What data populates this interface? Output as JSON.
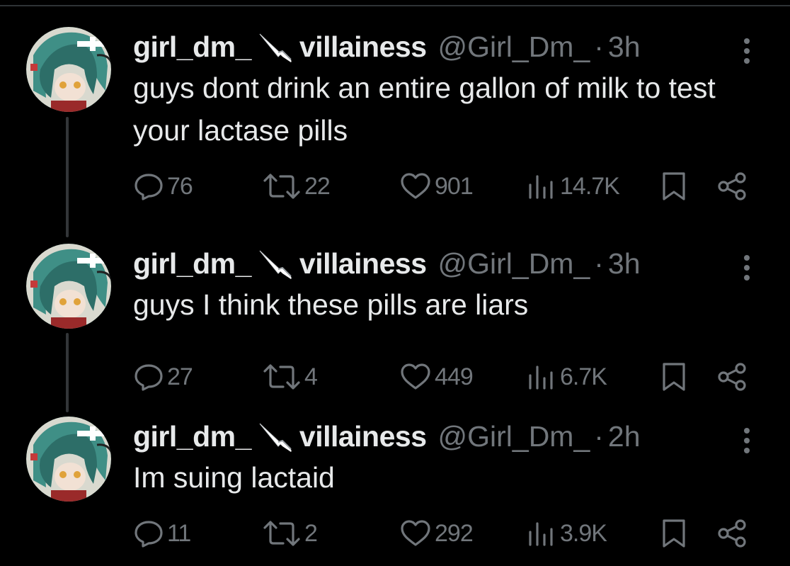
{
  "tweets": [
    {
      "display_name": "girl_dm_",
      "name_suffix": "villainess",
      "handle": "@Girl_Dm_",
      "separator": "·",
      "time": "3h",
      "text": "guys dont drink an entire gallon of milk to test your lactase pills",
      "replies": "76",
      "retweets": "22",
      "likes": "901",
      "views": "14.7K"
    },
    {
      "display_name": "girl_dm_",
      "name_suffix": "villainess",
      "handle": "@Girl_Dm_",
      "separator": "·",
      "time": "3h",
      "text": "guys I think these pills are liars",
      "replies": "27",
      "retweets": "4",
      "likes": "449",
      "views": "6.7K"
    },
    {
      "display_name": "girl_dm_",
      "name_suffix": "villainess",
      "handle": "@Girl_Dm_",
      "separator": "·",
      "time": "2h",
      "text": "Im suing lactaid",
      "replies": "11",
      "retweets": "2",
      "likes": "292",
      "views": "3.9K"
    }
  ],
  "icons": {
    "name_emoji": "knife-icon",
    "more": "more-options-icon",
    "reply": "reply-icon",
    "retweet": "retweet-icon",
    "like": "heart-icon",
    "views": "views-icon",
    "bookmark": "bookmark-icon",
    "share": "share-icon"
  },
  "colors": {
    "background": "#000000",
    "primary_text": "#e7e9ea",
    "secondary_text": "#71767b",
    "thread_line": "#333639"
  }
}
